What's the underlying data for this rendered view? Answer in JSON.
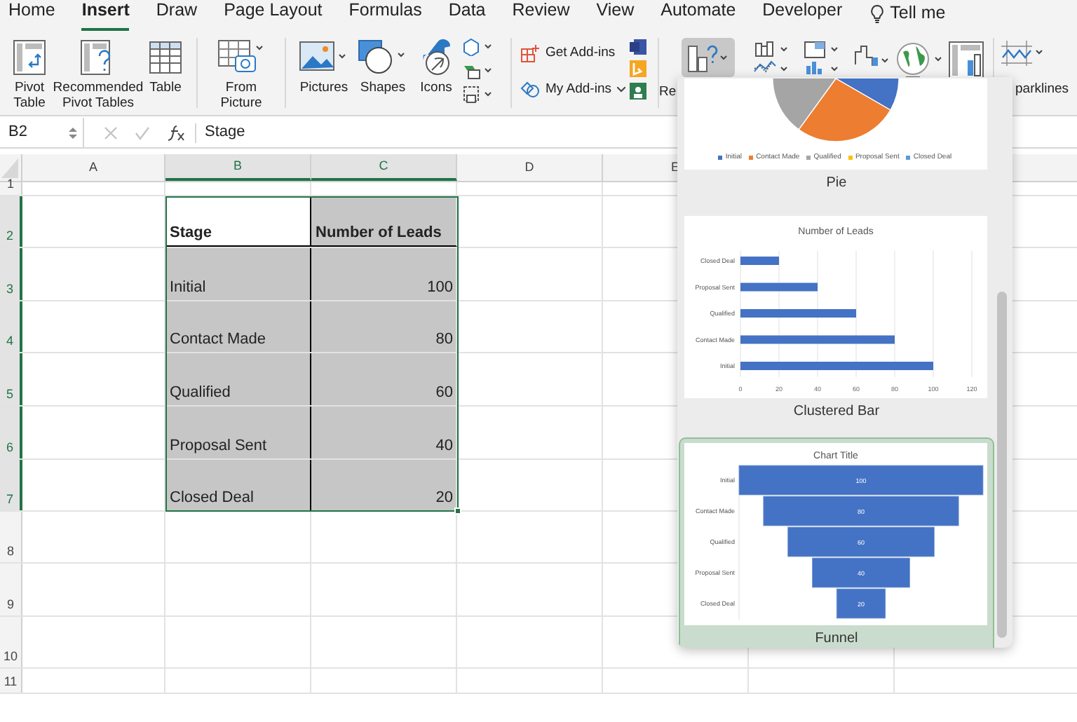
{
  "menu_tabs": [
    {
      "label": "Home",
      "selected": false
    },
    {
      "label": "Insert",
      "selected": true
    },
    {
      "label": "Draw",
      "selected": false
    },
    {
      "label": "Page Layout",
      "selected": false
    },
    {
      "label": "Formulas",
      "selected": false
    },
    {
      "label": "Data",
      "selected": false
    },
    {
      "label": "Review",
      "selected": false
    },
    {
      "label": "View",
      "selected": false
    },
    {
      "label": "Automate",
      "selected": false
    },
    {
      "label": "Developer",
      "selected": false
    }
  ],
  "tell_me": {
    "label": "Tell me"
  },
  "ribbon": {
    "large_buttons": [
      {
        "label": "Pivot Table"
      },
      {
        "label": "Recommended Pivot Tables"
      },
      {
        "label": "Table"
      },
      {
        "label": "From Picture"
      },
      {
        "label": "Pictures"
      },
      {
        "label": "Shapes"
      },
      {
        "label": "Icons"
      }
    ],
    "addins": [
      {
        "label": "Get Add-ins"
      },
      {
        "label": "My Add-ins"
      }
    ],
    "recommended_charts": {
      "label": "Re",
      "pressed": true
    },
    "sparklines": {
      "label": "parklines"
    }
  },
  "formula_bar": {
    "name_box": "B2",
    "value": "Stage"
  },
  "sheet": {
    "columns": [
      {
        "label": "A",
        "selected": false
      },
      {
        "label": "B",
        "selected": true
      },
      {
        "label": "C",
        "selected": true
      },
      {
        "label": "D",
        "selected": false
      },
      {
        "label": "E",
        "selected": false
      }
    ],
    "rows": [
      {
        "label": "1",
        "selected": false
      },
      {
        "label": "2",
        "selected": true
      },
      {
        "label": "3",
        "selected": true
      },
      {
        "label": "4",
        "selected": true
      },
      {
        "label": "5",
        "selected": true
      },
      {
        "label": "6",
        "selected": true
      },
      {
        "label": "7",
        "selected": true
      },
      {
        "label": "8",
        "selected": false
      },
      {
        "label": "9",
        "selected": false
      },
      {
        "label": "10",
        "selected": false
      },
      {
        "label": "11",
        "selected": false
      }
    ],
    "table": {
      "header": [
        "Stage",
        "Number of Leads"
      ],
      "rows": [
        [
          "Initial",
          "100"
        ],
        [
          "Contact Made",
          "80"
        ],
        [
          "Qualified",
          "60"
        ],
        [
          "Proposal Sent",
          "40"
        ],
        [
          "Closed Deal",
          "20"
        ]
      ]
    }
  },
  "chart_gallery": {
    "items": [
      {
        "kind": "pie",
        "label": "Pie",
        "selected": false,
        "legend": [
          {
            "name": "Initial",
            "color": "#4472c4"
          },
          {
            "name": "Contact Made",
            "color": "#ed7d31"
          },
          {
            "name": "Qualified",
            "color": "#a5a5a5"
          },
          {
            "name": "Proposal Sent",
            "color": "#ffc000"
          },
          {
            "name": "Closed Deal",
            "color": "#5b9bd5"
          }
        ]
      },
      {
        "kind": "bar",
        "label": "Clustered Bar",
        "selected": false,
        "chart_data": {
          "type": "bar",
          "orientation": "horizontal",
          "title": "Number of Leads",
          "categories": [
            "Closed Deal",
            "Proposal Sent",
            "Qualified",
            "Contact Made",
            "Initial"
          ],
          "series": [
            {
              "color": "#4472c4",
              "values": [
                20,
                40,
                60,
                80,
                100
              ]
            }
          ],
          "xlim": [
            0,
            120
          ],
          "xticks": [
            0,
            20,
            40,
            60,
            80,
            100,
            120
          ],
          "grid": true
        }
      },
      {
        "kind": "funnel",
        "label": "Funnel",
        "selected": true,
        "title": "Chart Title",
        "stages": [
          {
            "label": "Initial",
            "value": "100"
          },
          {
            "label": "Contact Made",
            "value": "80"
          },
          {
            "label": "Qualified",
            "value": "60"
          },
          {
            "label": "Proposal Sent",
            "value": "40"
          },
          {
            "label": "Closed Deal",
            "value": "20"
          }
        ]
      }
    ]
  }
}
